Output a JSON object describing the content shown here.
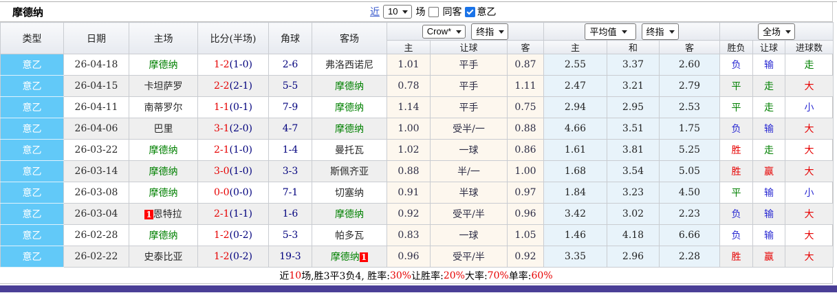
{
  "title": "摩德纳",
  "topbar": {
    "recent_link": "近",
    "recent_select": "10",
    "matches_label": "场",
    "same_away": {
      "label": "同客",
      "checked": false
    },
    "league_filter": {
      "label": "意乙",
      "checked": true
    }
  },
  "header": {
    "left": [
      "类型",
      "日期",
      "主场",
      "比分(半场)",
      "角球",
      "客场"
    ],
    "selects": {
      "bookmaker": "Crow*",
      "bookmaker_stage": "终指",
      "average": "平均值",
      "average_stage": "终指",
      "scope": "全场"
    },
    "sub": [
      "主",
      "让球",
      "客",
      "主",
      "和",
      "客",
      "胜负",
      "让球",
      "进球数"
    ]
  },
  "rows": [
    {
      "league": "意乙",
      "date": "26-04-18",
      "home": "摩德纳",
      "home_badge": "",
      "score": "1-2",
      "half": "(1-0)",
      "corner": "2-6",
      "away": "弗洛西诺尼",
      "away_badge": "",
      "o1": "1.01",
      "line": "平手",
      "o2": "0.87",
      "a1": "2.55",
      "a2": "3.37",
      "a3": "2.60",
      "wdl": "负",
      "rl": "输",
      "goals": "走"
    },
    {
      "league": "意乙",
      "date": "26-04-15",
      "home": "卡坦萨罗",
      "home_badge": "",
      "score": "2-2",
      "half": "(2-1)",
      "corner": "5-5",
      "away": "摩德纳",
      "away_badge": "",
      "o1": "0.78",
      "line": "平手",
      "o2": "1.11",
      "a1": "2.47",
      "a2": "3.21",
      "a3": "2.79",
      "wdl": "平",
      "rl": "走",
      "goals": "大"
    },
    {
      "league": "意乙",
      "date": "26-04-11",
      "home": "南蒂罗尔",
      "home_badge": "",
      "score": "1-1",
      "half": "(0-1)",
      "corner": "7-9",
      "away": "摩德纳",
      "away_badge": "",
      "o1": "1.14",
      "line": "平手",
      "o2": "0.75",
      "a1": "2.94",
      "a2": "2.95",
      "a3": "2.53",
      "wdl": "平",
      "rl": "走",
      "goals": "小"
    },
    {
      "league": "意乙",
      "date": "26-04-06",
      "home": "巴里",
      "home_badge": "",
      "score": "3-1",
      "half": "(2-0)",
      "corner": "4-7",
      "away": "摩德纳",
      "away_badge": "",
      "o1": "1.00",
      "line": "受半/一",
      "o2": "0.88",
      "a1": "4.66",
      "a2": "3.51",
      "a3": "1.75",
      "wdl": "负",
      "rl": "输",
      "goals": "大"
    },
    {
      "league": "意乙",
      "date": "26-03-22",
      "home": "摩德纳",
      "home_badge": "",
      "score": "2-1",
      "half": "(1-0)",
      "corner": "1-4",
      "away": "曼托瓦",
      "away_badge": "",
      "o1": "1.02",
      "line": "一球",
      "o2": "0.86",
      "a1": "1.61",
      "a2": "3.81",
      "a3": "5.25",
      "wdl": "胜",
      "rl": "走",
      "goals": "大"
    },
    {
      "league": "意乙",
      "date": "26-03-14",
      "home": "摩德纳",
      "home_badge": "",
      "score": "3-0",
      "half": "(1-0)",
      "corner": "3-3",
      "away": "斯佩齐亚",
      "away_badge": "",
      "o1": "0.88",
      "line": "半/一",
      "o2": "1.00",
      "a1": "1.68",
      "a2": "3.54",
      "a3": "5.05",
      "wdl": "胜",
      "rl": "赢",
      "goals": "大"
    },
    {
      "league": "意乙",
      "date": "26-03-08",
      "home": "摩德纳",
      "home_badge": "",
      "score": "0-0",
      "half": "(0-0)",
      "corner": "7-1",
      "away": "切塞纳",
      "away_badge": "",
      "o1": "0.91",
      "line": "半球",
      "o2": "0.97",
      "a1": "1.84",
      "a2": "3.23",
      "a3": "4.50",
      "wdl": "平",
      "rl": "输",
      "goals": "小"
    },
    {
      "league": "意乙",
      "date": "26-03-04",
      "home": "恩特拉",
      "home_badge": "1",
      "score": "2-1",
      "half": "(1-1)",
      "corner": "1-6",
      "away": "摩德纳",
      "away_badge": "",
      "o1": "0.92",
      "line": "受平/半",
      "o2": "0.96",
      "a1": "3.42",
      "a2": "3.02",
      "a3": "2.23",
      "wdl": "负",
      "rl": "输",
      "goals": "大"
    },
    {
      "league": "意乙",
      "date": "26-02-28",
      "home": "摩德纳",
      "home_badge": "",
      "score": "1-2",
      "half": "(0-2)",
      "corner": "5-3",
      "away": "帕多瓦",
      "away_badge": "",
      "o1": "0.83",
      "line": "一球",
      "o2": "1.05",
      "a1": "1.46",
      "a2": "4.18",
      "a3": "6.66",
      "wdl": "负",
      "rl": "输",
      "goals": "大"
    },
    {
      "league": "意乙",
      "date": "26-02-22",
      "home": "史泰比亚",
      "home_badge": "",
      "score": "1-2",
      "half": "(0-2)",
      "corner": "19-3",
      "away": "摩德纳",
      "away_badge": "1",
      "o1": "0.96",
      "line": "受平/半",
      "o2": "0.92",
      "a1": "3.35",
      "a2": "2.96",
      "a3": "2.28",
      "wdl": "胜",
      "rl": "赢",
      "goals": "大"
    }
  ],
  "footer": {
    "parts": [
      {
        "t": "近"
      },
      {
        "t": "10"
      },
      {
        "t": "场,胜3平3负4, 胜率:"
      },
      {
        "t": "30%"
      },
      {
        "t": " 让胜率:"
      },
      {
        "t": "20%"
      },
      {
        "t": " 大率:"
      },
      {
        "t": "70%"
      },
      {
        "t": " 单率:"
      },
      {
        "t": "60%"
      }
    ]
  },
  "colors": {
    "league_cell_bg": "#62c9f8",
    "odds_bg": "#fdf7ee",
    "avg_bg": "#e8f3fa",
    "win_red": "#e60000",
    "draw_green": "#008000",
    "lose_blue": "#2a2ad2",
    "modena_green": "#008000",
    "bottom_bar": "#4a3e96",
    "badge_red": "#ff0000"
  }
}
